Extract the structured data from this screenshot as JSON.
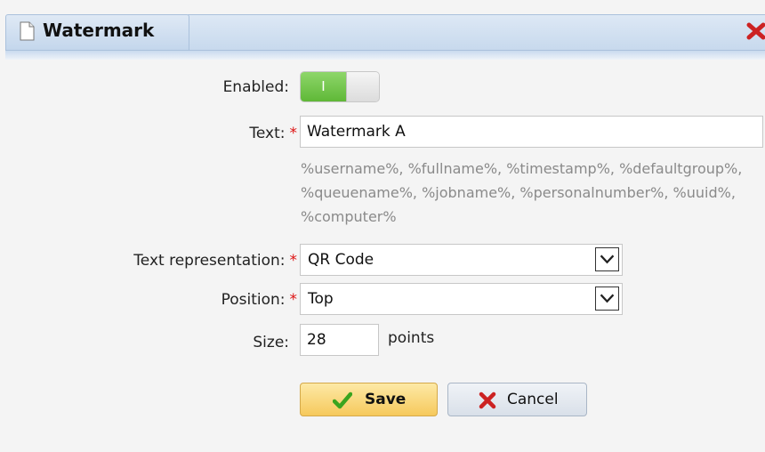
{
  "dialog": {
    "title": "Watermark",
    "icons": {
      "title": "document-icon",
      "close": "close-icon"
    }
  },
  "form": {
    "enabled": {
      "label": "Enabled:",
      "toggle_text": "I",
      "state": "on"
    },
    "text": {
      "label": "Text:",
      "required_mark": "*",
      "value": "Watermark A",
      "hint_lines": [
        "%username%, %fullname%, %timestamp%, %defaultgroup%,",
        "%queuename%, %jobname%, %personalnumber%, %uuid%,",
        "%computer%"
      ]
    },
    "text_representation": {
      "label": "Text representation:",
      "required_mark": "*",
      "value": "QR Code"
    },
    "position": {
      "label": "Position:",
      "required_mark": "*",
      "value": "Top"
    },
    "size": {
      "label": "Size:",
      "value": "28",
      "units": "points"
    }
  },
  "buttons": {
    "save": {
      "label": "Save",
      "icon": "checkmark-icon"
    },
    "cancel": {
      "label": "Cancel",
      "icon": "x-icon"
    }
  },
  "colors": {
    "toggle_on": "#6cc144",
    "save_bg": "#f8d36e",
    "required": "#dd1111",
    "close": "#cc2222"
  }
}
